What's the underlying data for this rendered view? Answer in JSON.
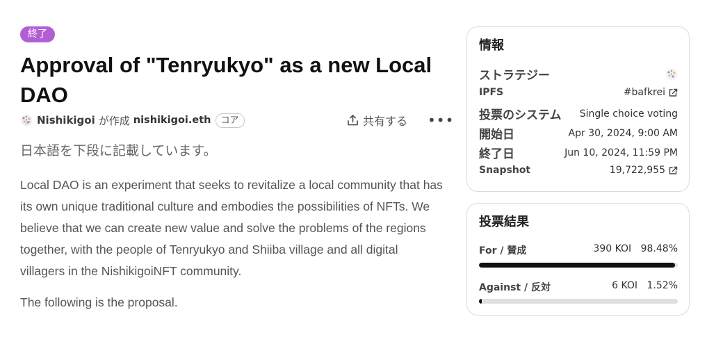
{
  "proposal": {
    "status_badge": "終了",
    "title": "Approval of \"Tenryukyo\" as a new Local DAO",
    "author_name": "Nishikigoi",
    "created_label": "が作成",
    "author_ens": "nishikigoi.eth",
    "core_badge": "コア",
    "share_label": "共有する",
    "more_label": "•••",
    "subtitle": "日本語を下段に記載しています。",
    "body": "Local DAO is an experiment that seeks to revitalize a local community that has its own unique traditional culture and embodies the possibilities of NFTs. We believe that we can create new value and solve the problems of the regions together, with the people of Tenryukyo and Shiiba village and all digital villagers in the NishikigoiNFT community.",
    "body2": "The following is the proposal."
  },
  "info": {
    "title": "情報",
    "strategy_label": "ストラテジー",
    "ipfs_label": "IPFS",
    "ipfs_value": "#bafkrei",
    "voting_system_label": "投票のシステム",
    "voting_system_value": "Single choice voting",
    "start_label": "開始日",
    "start_value": "Apr 30, 2024, 9:00 AM",
    "end_label": "終了日",
    "end_value": "Jun 10, 2024, 11:59 PM",
    "snapshot_label": "Snapshot",
    "snapshot_value": "19,722,955"
  },
  "results": {
    "title": "投票結果",
    "choices": [
      {
        "label": "For / 賛成",
        "amount": "390 KOI",
        "percent": "98.48%",
        "fraction": 0.9848
      },
      {
        "label": "Against / 反対",
        "amount": "6 KOI",
        "percent": "1.52%",
        "fraction": 0.0152
      }
    ]
  },
  "colors": {
    "badge": "#b25fd6",
    "bar_fill": "#111111",
    "bar_track": "#e0e0e0"
  },
  "icons": [
    "share-icon",
    "more-icon",
    "external-link-icon",
    "avatar-icon",
    "strategy-icon"
  ]
}
